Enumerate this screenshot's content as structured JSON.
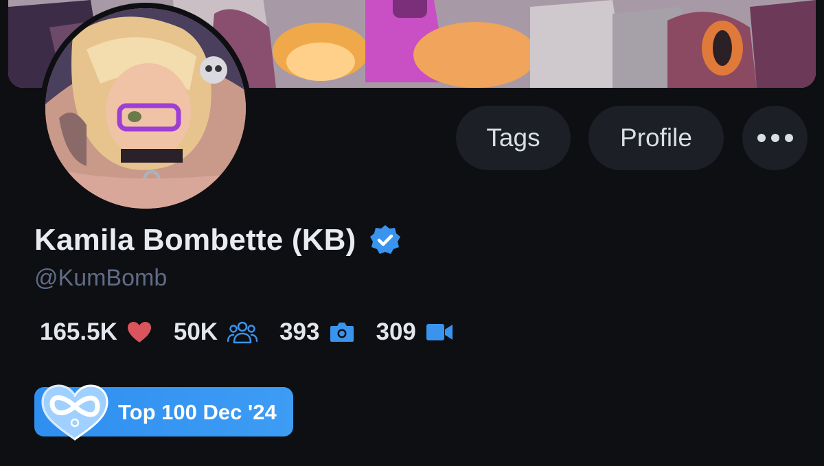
{
  "actions": {
    "tags_label": "Tags",
    "profile_label": "Profile",
    "more_icon": "more-horizontal-icon"
  },
  "profile": {
    "display_name": "Kamila Bombette (KB)",
    "verified": true,
    "handle": "@KumBomb"
  },
  "stats": [
    {
      "value": "165.5K",
      "icon": "heart-icon",
      "color": "#d9545c"
    },
    {
      "value": "50K",
      "icon": "users-icon",
      "color": "#3a94ee"
    },
    {
      "value": "393",
      "icon": "camera-icon",
      "color": "#3a94ee"
    },
    {
      "value": "309",
      "icon": "video-icon",
      "color": "#3a94ee"
    }
  ],
  "badge": {
    "label": "Top 100 Dec '24",
    "icon": "infinity-heart-icon"
  },
  "colors": {
    "background": "#0e0f13",
    "accent_blue": "#3a94ee",
    "pill_bg": "#1c1f26",
    "handle_text": "#5f6c86"
  }
}
